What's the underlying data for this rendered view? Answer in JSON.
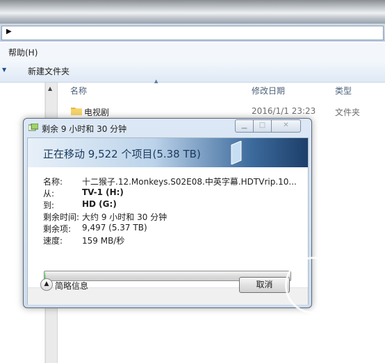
{
  "explorer": {
    "menu_help": "帮助(H)",
    "new_folder": "新建文件夹",
    "columns": {
      "name": "名称",
      "modified": "修改日期",
      "type": "类型"
    },
    "rows": [
      {
        "name": "电视剧",
        "modified": "2016/1/1 23:23",
        "type": "文件夹"
      }
    ]
  },
  "dialog": {
    "title": "剩余 9 小时和 30 分钟",
    "heading": "正在移动 9,522 个项目(5.38 TB)",
    "fields": [
      {
        "label": "名称:",
        "value": "十二猴子.12.Monkeys.S02E08.中英字幕.HDTVrip.10..."
      },
      {
        "label": "从:",
        "value": "TV-1 (H:)"
      },
      {
        "label": "到:",
        "value": "HD (G:)"
      },
      {
        "label": "剩余时间:",
        "value": "大约 9 小时和 30 分钟"
      },
      {
        "label": "剩余项:",
        "value": "9,497 (5.37 TB)"
      },
      {
        "label": "速度:",
        "value": "159 MB/秒"
      }
    ],
    "progress": 0.005,
    "details_label": "简略信息",
    "cancel_label": "取消"
  }
}
